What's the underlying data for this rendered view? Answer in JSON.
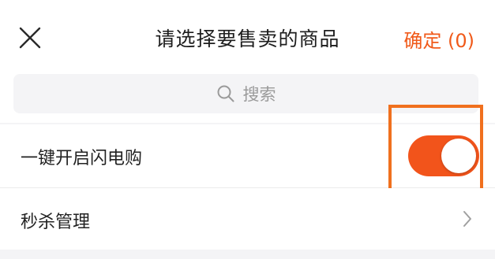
{
  "header": {
    "title": "请选择要售卖的商品",
    "close_icon": "close-icon",
    "confirm_label": "确定 (0)"
  },
  "search": {
    "icon": "search-icon",
    "placeholder": "搜索"
  },
  "settings": {
    "flash_sale": {
      "label": "一键开启闪电购",
      "enabled": true
    },
    "seckill": {
      "label": "秒杀管理",
      "icon": "chevron-right-icon"
    }
  },
  "colors": {
    "accent": "#f05a1a",
    "toggle_on": "#f2541b",
    "highlight_border": "#f0701e"
  }
}
